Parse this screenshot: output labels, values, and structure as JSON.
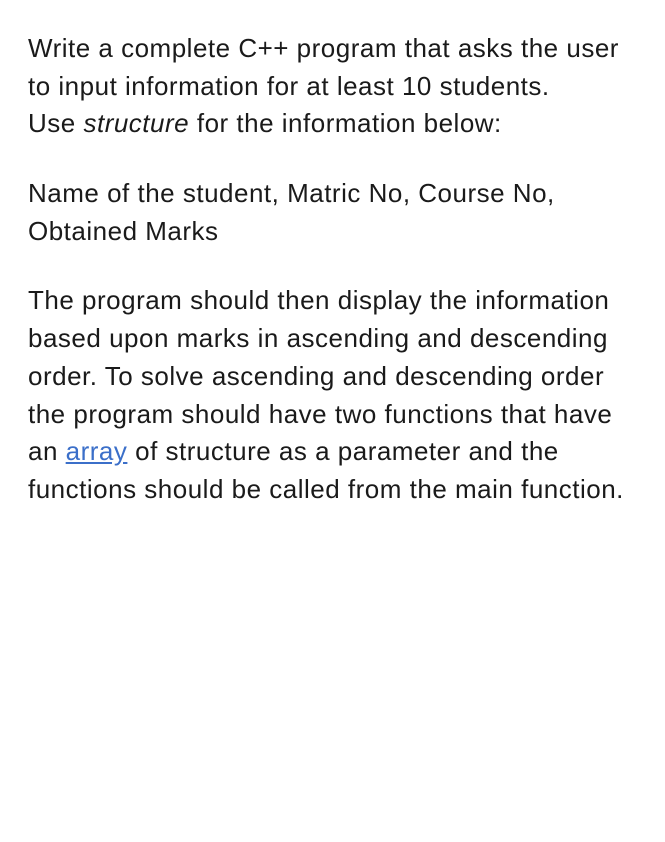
{
  "paragraphs": {
    "p1_part1": "Write a complete C++ program that asks the user to input information for at least 10 students.",
    "p1_part2a": "Use ",
    "p1_structure": "structure",
    "p1_part2b": "  for the information below:",
    "p2": "Name of the student, Matric No, Course No, Obtained Marks",
    "p3_part1": "The program should then display the information based upon marks in ascending and descending order. To solve ascending and descending order the program should have two functions that have an ",
    "p3_link": "array",
    "p3_part2": " of structure as a parameter and the functions should be called from the main function."
  }
}
